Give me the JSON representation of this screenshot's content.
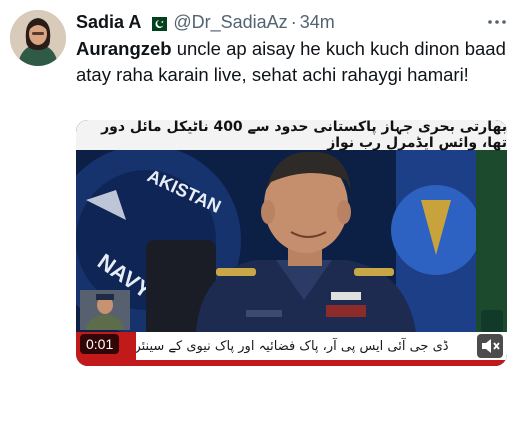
{
  "author": {
    "display_name": "Sadia A",
    "handle": "@Dr_SadiaAz",
    "separator": "·",
    "time": "34m",
    "flag_icon": "pakistan-flag-icon"
  },
  "tweet": {
    "mention": "Aurangzeb",
    "body": " uncle ap aisay he kuch kuch dinon baad atay raha karain live, sehat achi rahaygi hamari!"
  },
  "video": {
    "headline": "بھارتی بحری جہاز پاکستانی حدود سے 400 ناٹیکل مائل دور تھا، وائس ایڈمرل رب نواز",
    "ticker": "ڈی جی آئی ایس پی آر، پاک فضائیہ اور پاک نیوی کے سینئر",
    "timecode": "0:01",
    "mute_icon": "speaker-mute-icon"
  },
  "colors": {
    "text_primary": "#0f1419",
    "text_secondary": "#536471",
    "ticker_red": "#c21a1a",
    "uniform_blue": "#1c2b4f"
  }
}
